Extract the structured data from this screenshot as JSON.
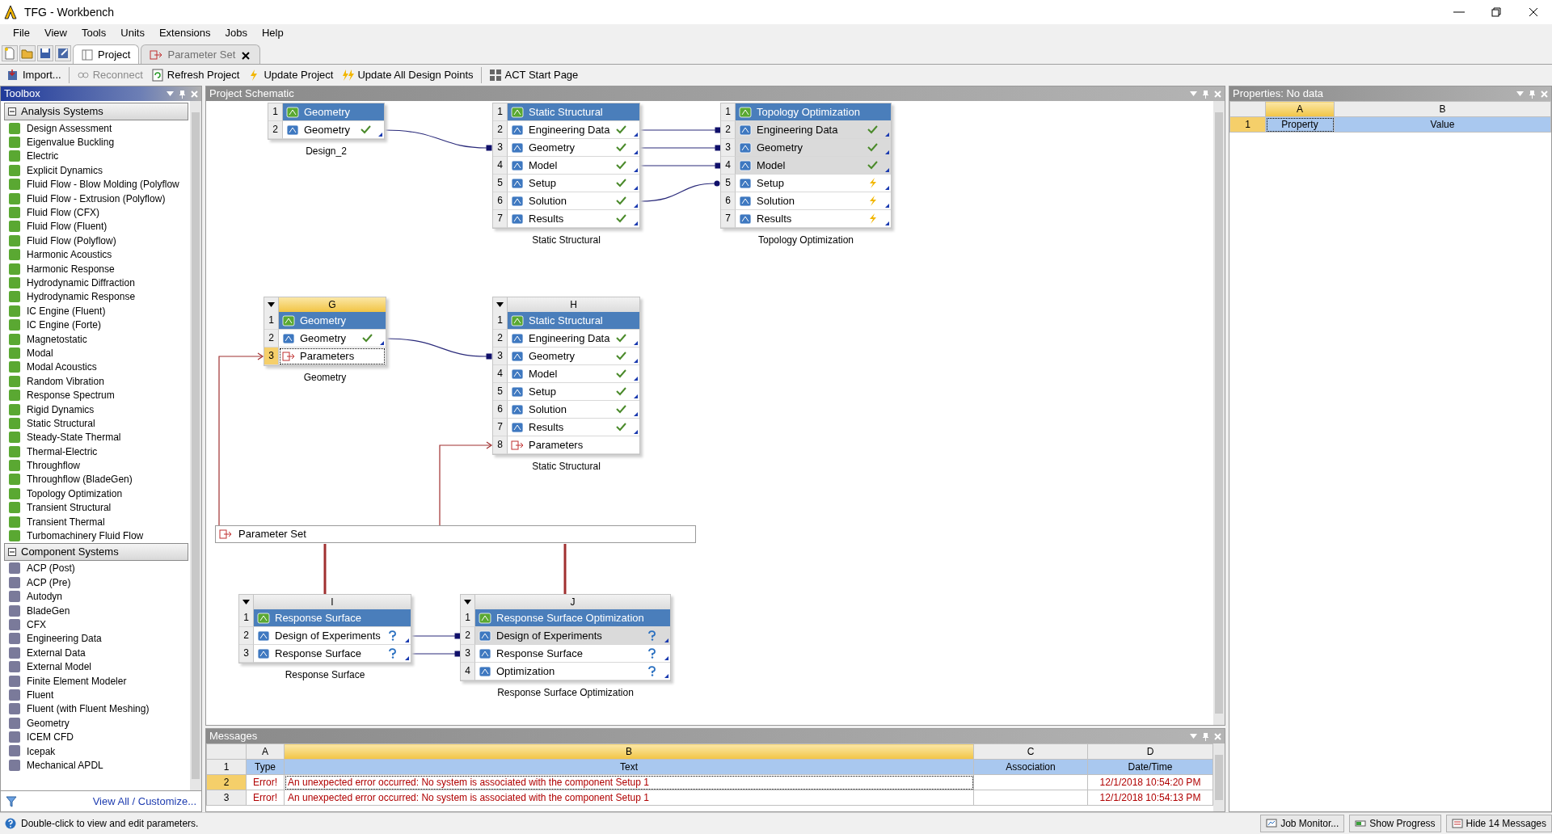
{
  "window": {
    "title": "TFG - Workbench"
  },
  "menu": [
    "File",
    "View",
    "Tools",
    "Units",
    "Extensions",
    "Jobs",
    "Help"
  ],
  "tabs": [
    {
      "label": "Project",
      "selected": true,
      "closable": false
    },
    {
      "label": "Parameter Set",
      "selected": false,
      "closable": true
    }
  ],
  "toolbar": [
    {
      "label": "Import...",
      "disabled": false,
      "separator_after": true
    },
    {
      "label": "Reconnect",
      "disabled": true,
      "separator_after": false
    },
    {
      "label": "Refresh Project",
      "disabled": false,
      "separator_after": false
    },
    {
      "label": "Update Project",
      "disabled": false,
      "separator_after": false
    },
    {
      "label": "Update All Design Points",
      "disabled": false,
      "separator_after": true
    },
    {
      "label": "ACT Start Page",
      "disabled": false,
      "separator_after": false
    }
  ],
  "toolbox": {
    "title": "Toolbox",
    "groups": [
      {
        "title": "Analysis Systems",
        "expanded": true,
        "items": [
          "Design Assessment",
          "Eigenvalue Buckling",
          "Electric",
          "Explicit Dynamics",
          "Fluid Flow - Blow Molding (Polyflow",
          "Fluid Flow - Extrusion (Polyflow)",
          "Fluid Flow (CFX)",
          "Fluid Flow (Fluent)",
          "Fluid Flow (Polyflow)",
          "Harmonic Acoustics",
          "Harmonic Response",
          "Hydrodynamic Diffraction",
          "Hydrodynamic Response",
          "IC Engine (Fluent)",
          "IC Engine (Forte)",
          "Magnetostatic",
          "Modal",
          "Modal Acoustics",
          "Random Vibration",
          "Response Spectrum",
          "Rigid Dynamics",
          "Static Structural",
          "Steady-State Thermal",
          "Thermal-Electric",
          "Throughflow",
          "Throughflow (BladeGen)",
          "Topology Optimization",
          "Transient Structural",
          "Transient Thermal",
          "Turbomachinery Fluid Flow"
        ]
      },
      {
        "title": "Component Systems",
        "expanded": true,
        "items": [
          "ACP (Post)",
          "ACP (Pre)",
          "Autodyn",
          "BladeGen",
          "CFX",
          "Engineering Data",
          "External Data",
          "External Model",
          "Finite Element Modeler",
          "Fluent",
          "Fluent (with Fluent Meshing)",
          "Geometry",
          "ICEM CFD",
          "Icepak",
          "Mechanical APDL"
        ]
      }
    ],
    "footer": "View All / Customize..."
  },
  "schematic": {
    "title": "Project Schematic",
    "systems": [
      {
        "caption": "Design_2",
        "rows": [
          {
            "num": "1",
            "kind": "title",
            "label": "Geometry"
          },
          {
            "num": "2",
            "kind": "done",
            "label": "Geometry"
          }
        ]
      },
      {
        "caption": "Static Structural",
        "rows": [
          {
            "num": "1",
            "kind": "title",
            "label": "Static Structural"
          },
          {
            "num": "2",
            "kind": "done",
            "label": "Engineering Data"
          },
          {
            "num": "3",
            "kind": "done",
            "label": "Geometry"
          },
          {
            "num": "4",
            "kind": "done",
            "label": "Model"
          },
          {
            "num": "5",
            "kind": "done",
            "label": "Setup"
          },
          {
            "num": "6",
            "kind": "done",
            "label": "Solution"
          },
          {
            "num": "7",
            "kind": "done",
            "label": "Results"
          }
        ]
      },
      {
        "caption": "Topology Optimization",
        "rows": [
          {
            "num": "1",
            "kind": "title",
            "label": "Topology Optimization",
            "shared": false
          },
          {
            "num": "2",
            "kind": "done",
            "label": "Engineering Data",
            "shared": true
          },
          {
            "num": "3",
            "kind": "done",
            "label": "Geometry",
            "shared": true
          },
          {
            "num": "4",
            "kind": "done",
            "label": "Model",
            "shared": true
          },
          {
            "num": "5",
            "kind": "update",
            "label": "Setup",
            "shared": false
          },
          {
            "num": "6",
            "kind": "update",
            "label": "Solution",
            "shared": false
          },
          {
            "num": "7",
            "kind": "update",
            "label": "Results",
            "shared": false
          }
        ]
      },
      {
        "letter": "G",
        "selected": true,
        "caption": "Geometry",
        "rows": [
          {
            "num": "1",
            "kind": "title",
            "label": "Geometry",
            "selected": false
          },
          {
            "num": "2",
            "kind": "done",
            "label": "Geometry",
            "selected": false
          },
          {
            "num": "3",
            "kind": "parameters",
            "label": "Parameters",
            "selected": true
          }
        ]
      },
      {
        "letter": "H",
        "selected": false,
        "caption": "Static Structural",
        "rows": [
          {
            "num": "1",
            "kind": "title",
            "label": "Static Structural"
          },
          {
            "num": "2",
            "kind": "done",
            "label": "Engineering Data"
          },
          {
            "num": "3",
            "kind": "done",
            "label": "Geometry"
          },
          {
            "num": "4",
            "kind": "done",
            "label": "Model"
          },
          {
            "num": "5",
            "kind": "done",
            "label": "Setup"
          },
          {
            "num": "6",
            "kind": "done",
            "label": "Solution"
          },
          {
            "num": "7",
            "kind": "done",
            "label": "Results"
          },
          {
            "num": "8",
            "kind": "parameters",
            "label": "Parameters"
          }
        ]
      },
      {
        "letter": "I",
        "selected": false,
        "caption": "Response Surface",
        "rows": [
          {
            "num": "1",
            "kind": "title",
            "label": "Response Surface"
          },
          {
            "num": "2",
            "kind": "unknown",
            "label": "Design of Experiments"
          },
          {
            "num": "3",
            "kind": "unknown",
            "label": "Response Surface"
          }
        ]
      },
      {
        "letter": "J",
        "selected": false,
        "caption": "Response Surface Optimization",
        "rows": [
          {
            "num": "1",
            "kind": "title",
            "label": "Response Surface Optimization",
            "shared": false
          },
          {
            "num": "2",
            "kind": "unknown",
            "label": "Design of Experiments",
            "shared": true
          },
          {
            "num": "3",
            "kind": "unknown",
            "label": "Response Surface",
            "shared": false
          },
          {
            "num": "4",
            "kind": "unknown",
            "label": "Optimization",
            "shared": false
          }
        ]
      }
    ],
    "parameter_set": {
      "label": "Parameter Set"
    }
  },
  "messages": {
    "title": "Messages",
    "columns": [
      {
        "letter": "A",
        "selected": false
      },
      {
        "letter": "B",
        "selected": true
      },
      {
        "letter": "C",
        "selected": false
      },
      {
        "letter": "D",
        "selected": false
      }
    ],
    "header": {
      "num": "1",
      "cells": [
        "Type",
        "Text",
        "Association",
        "Date/Time"
      ]
    },
    "rows": [
      {
        "num": "2",
        "selected": true,
        "type": "Error!",
        "text": "An unexpected error occurred: No system is associated with the component Setup 1",
        "date": "12/1/2018 10:54:20 PM"
      },
      {
        "num": "3",
        "selected": false,
        "type": "Error!",
        "text": "An unexpected error occurred: No system is associated with the component Setup 1",
        "date": "12/1/2018 10:54:13 PM"
      }
    ]
  },
  "properties": {
    "title": "Properties: No data",
    "columns": [
      {
        "letter": "A",
        "selected": true
      },
      {
        "letter": "B",
        "selected": false
      }
    ],
    "rows": [
      {
        "num": "1",
        "selected": true,
        "cells": [
          "Property",
          "Value"
        ]
      }
    ]
  },
  "status_bar": {
    "text": "Double-click to view and edit parameters.",
    "buttons": [
      "Job Monitor...",
      "Show Progress",
      "Hide 14 Messages"
    ]
  }
}
